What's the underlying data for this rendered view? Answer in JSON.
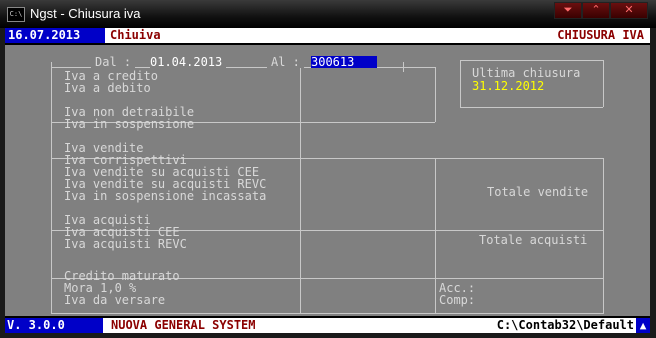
{
  "window": {
    "app_icon_text": "C:\\",
    "title": "Ngst - Chiusura iva",
    "buttons": [
      "⏷",
      "⌃",
      "✕"
    ]
  },
  "header": {
    "date": "16.07.2013",
    "program": "Chiuiva",
    "screen_title": "CHIUSURA IVA"
  },
  "form": {
    "dal_label": "Dal :",
    "dal_value": "01.04.2013",
    "al_label": "Al :",
    "al_value": "300613",
    "ultima_label": "Ultima chiusura",
    "ultima_value": "31.12.2012",
    "group1": [
      "Iva a credito",
      "Iva a debito"
    ],
    "group2": [
      "Iva non detraibile",
      "Iva in sospensione"
    ],
    "group3": [
      "Iva vendite",
      "Iva corrispettivi",
      "Iva vendite su acquisti CEE",
      "Iva vendite su acquisti REVC",
      "Iva in sospensione incassata"
    ],
    "group4": [
      "Iva acquisti",
      "Iva acquisti CEE",
      "Iva acquisti REVC"
    ],
    "group5": [
      "Credito maturato",
      "Mora 1,0 %",
      "Iva da versare"
    ],
    "totale_vendite": "Totale vendite",
    "totale_acquisti": "Totale acquisti",
    "acc_label": "Acc.:",
    "comp_label": "Comp:"
  },
  "footer": {
    "version": "V. 3.0.0",
    "system": "NUOVA GENERAL SYSTEM",
    "path": "C:\\Contab32\\Default",
    "scroll_icon": "up-arrow-icon"
  }
}
